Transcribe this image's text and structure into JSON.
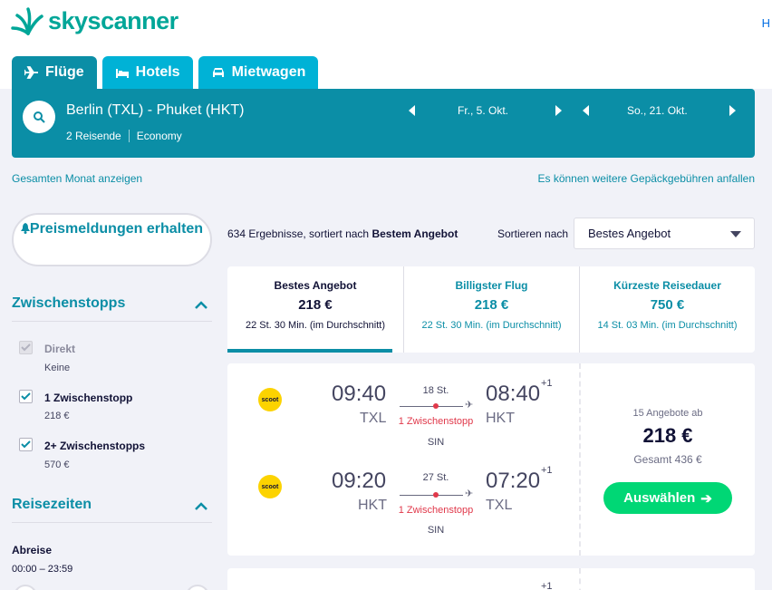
{
  "brand": {
    "name": "skyscanner",
    "color": "#00a698"
  },
  "header_link": "H",
  "tabs": [
    {
      "label": "Flüge",
      "icon": "plane-icon",
      "active": true
    },
    {
      "label": "Hotels",
      "icon": "bed-icon",
      "active": false
    },
    {
      "label": "Mietwagen",
      "icon": "car-icon",
      "active": false
    }
  ],
  "search": {
    "route": "Berlin (TXL) - Phuket (HKT)",
    "travellers": "2 Reisende",
    "cabin": "Economy",
    "depart_date": "Fr., 5. Okt.",
    "return_date": "So., 21. Okt."
  },
  "links": {
    "whole_month": "Gesamten Monat anzeigen",
    "baggage_fees": "Es können weitere Gepäckgebühren anfallen"
  },
  "price_alert": {
    "label": "Preismeldungen erhalten"
  },
  "filters": {
    "stops": {
      "title": "Zwischenstopps",
      "options": [
        {
          "label": "Direkt",
          "price": "Keine",
          "checked": true,
          "disabled": true
        },
        {
          "label": "1 Zwischenstopp",
          "price": "218 €",
          "checked": true,
          "disabled": false
        },
        {
          "label": "2+ Zwischenstopps",
          "price": "570 €",
          "checked": true,
          "disabled": false
        }
      ]
    },
    "times": {
      "title": "Reisezeiten",
      "departure_label": "Abreise",
      "departure_range": "00:00 – 23:59"
    }
  },
  "results": {
    "count_text": "634 Ergebnisse, sortiert nach",
    "sorted_by": "Bestem Angebot",
    "sort_label": "Sortieren nach",
    "sort_value": "Bestes Angebot"
  },
  "sort_tabs": [
    {
      "title": "Bestes Angebot",
      "price": "218 €",
      "duration": "22 St. 30 Min. (im Durchschnitt)",
      "active": true
    },
    {
      "title": "Billigster Flug",
      "price": "218 €",
      "duration": "22 St. 30 Min. (im Durchschnitt)",
      "active": false
    },
    {
      "title": "Kürzeste Reisedauer",
      "price": "750 €",
      "duration": "14 St. 03 Min. (im Durchschnitt)",
      "active": false
    }
  ],
  "flights": [
    {
      "legs": [
        {
          "airline": "scoot",
          "dep_time": "09:40",
          "dep_airport": "TXL",
          "arr_time": "08:40",
          "arr_airport": "HKT",
          "day_offset": "+1",
          "duration": "18 St.",
          "stops": "1 Zwischenstopp",
          "stop_code": "SIN"
        },
        {
          "airline": "scoot",
          "dep_time": "09:20",
          "dep_airport": "HKT",
          "arr_time": "07:20",
          "arr_airport": "TXL",
          "day_offset": "+1",
          "duration": "27 St.",
          "stops": "1 Zwischenstopp",
          "stop_code": "SIN"
        }
      ],
      "offers": "15 Angebote ab",
      "price": "218 €",
      "total": "Gesamt 436 €",
      "button": "Auswählen"
    },
    {
      "legs": [
        {
          "day_offset": "+1"
        }
      ]
    }
  ],
  "colors": {
    "teal": "#0b8ea6",
    "tab": "#00b2d6",
    "green": "#00d775",
    "red": "#e0384a"
  }
}
